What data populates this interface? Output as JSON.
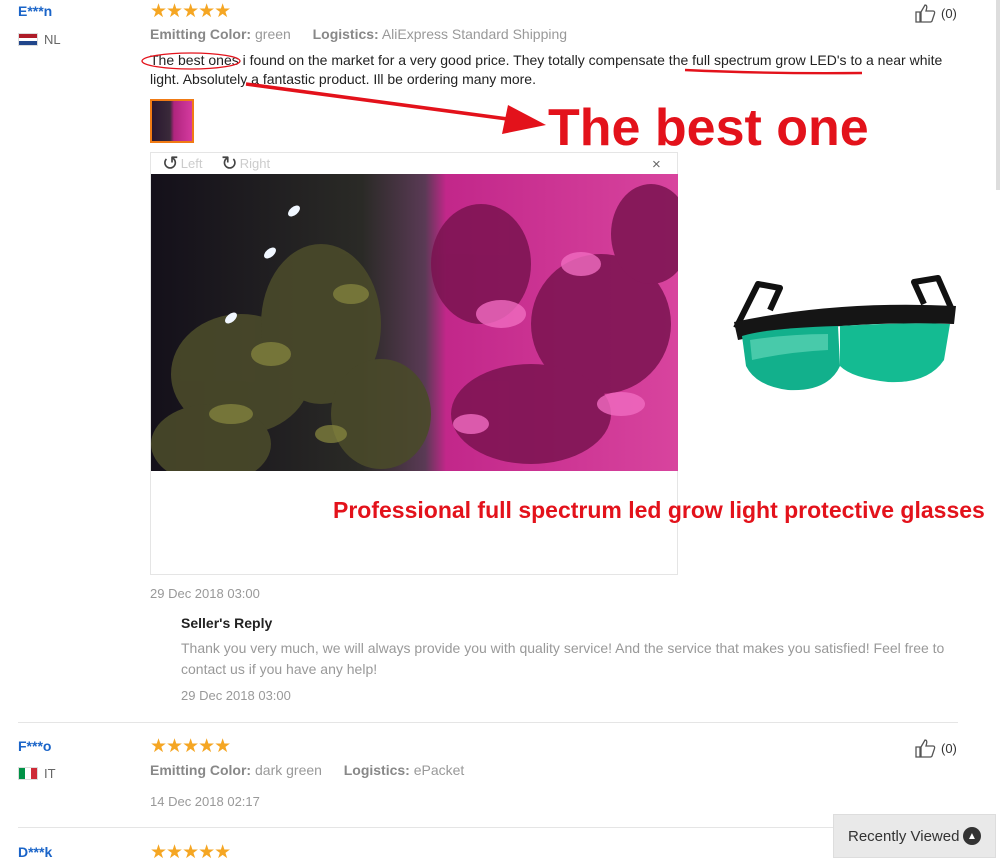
{
  "reviews": [
    {
      "user": "E***n",
      "country": "NL",
      "stars": "★★★★★",
      "attr1_label": "Emitting Color:",
      "attr1_value": "green",
      "attr2_label": "Logistics:",
      "attr2_value": "AliExpress Standard Shipping",
      "likes": "(0)",
      "text": "The best ones i found on the market for a very good price. They totally compensate the full spectrum grow LED's to a near white light. Absolutely a fantastic product. Ill be ordering many more.",
      "date": "29 Dec 2018 03:00",
      "reply_title": "Seller's Reply",
      "reply_text": "Thank you very much, we will always provide you with quality service! And the service that makes you satisfied! Feel free to contact us if you have any help!",
      "reply_date": "29 Dec 2018 03:00"
    },
    {
      "user": "F***o",
      "country": "IT",
      "stars": "★★★★★",
      "attr1_label": "Emitting Color:",
      "attr1_value": "dark green",
      "attr2_label": "Logistics:",
      "attr2_value": "ePacket",
      "likes": "(0)",
      "date": "14 Dec 2018 02:17"
    },
    {
      "user": "D***k",
      "stars": "★★★★★"
    }
  ],
  "viewer": {
    "rotate_left": "Left",
    "rotate_right": "Right",
    "close": "×"
  },
  "annotations": {
    "headline": "The best one",
    "caption": "Professional full spectrum led grow light protective glasses"
  },
  "recently_viewed": {
    "label": "Recently Viewed"
  },
  "icons": {
    "thumbs_up": "thumbs-up-icon",
    "rotate_left": "rotate-left-icon",
    "rotate_right": "rotate-right-icon",
    "close": "close-icon",
    "chevron_up": "chevron-up-icon"
  },
  "colors": {
    "username": "#1a64c8",
    "stars": "#f5a623",
    "annotation_red": "#e3121b",
    "thumb_border": "#f07b15"
  }
}
